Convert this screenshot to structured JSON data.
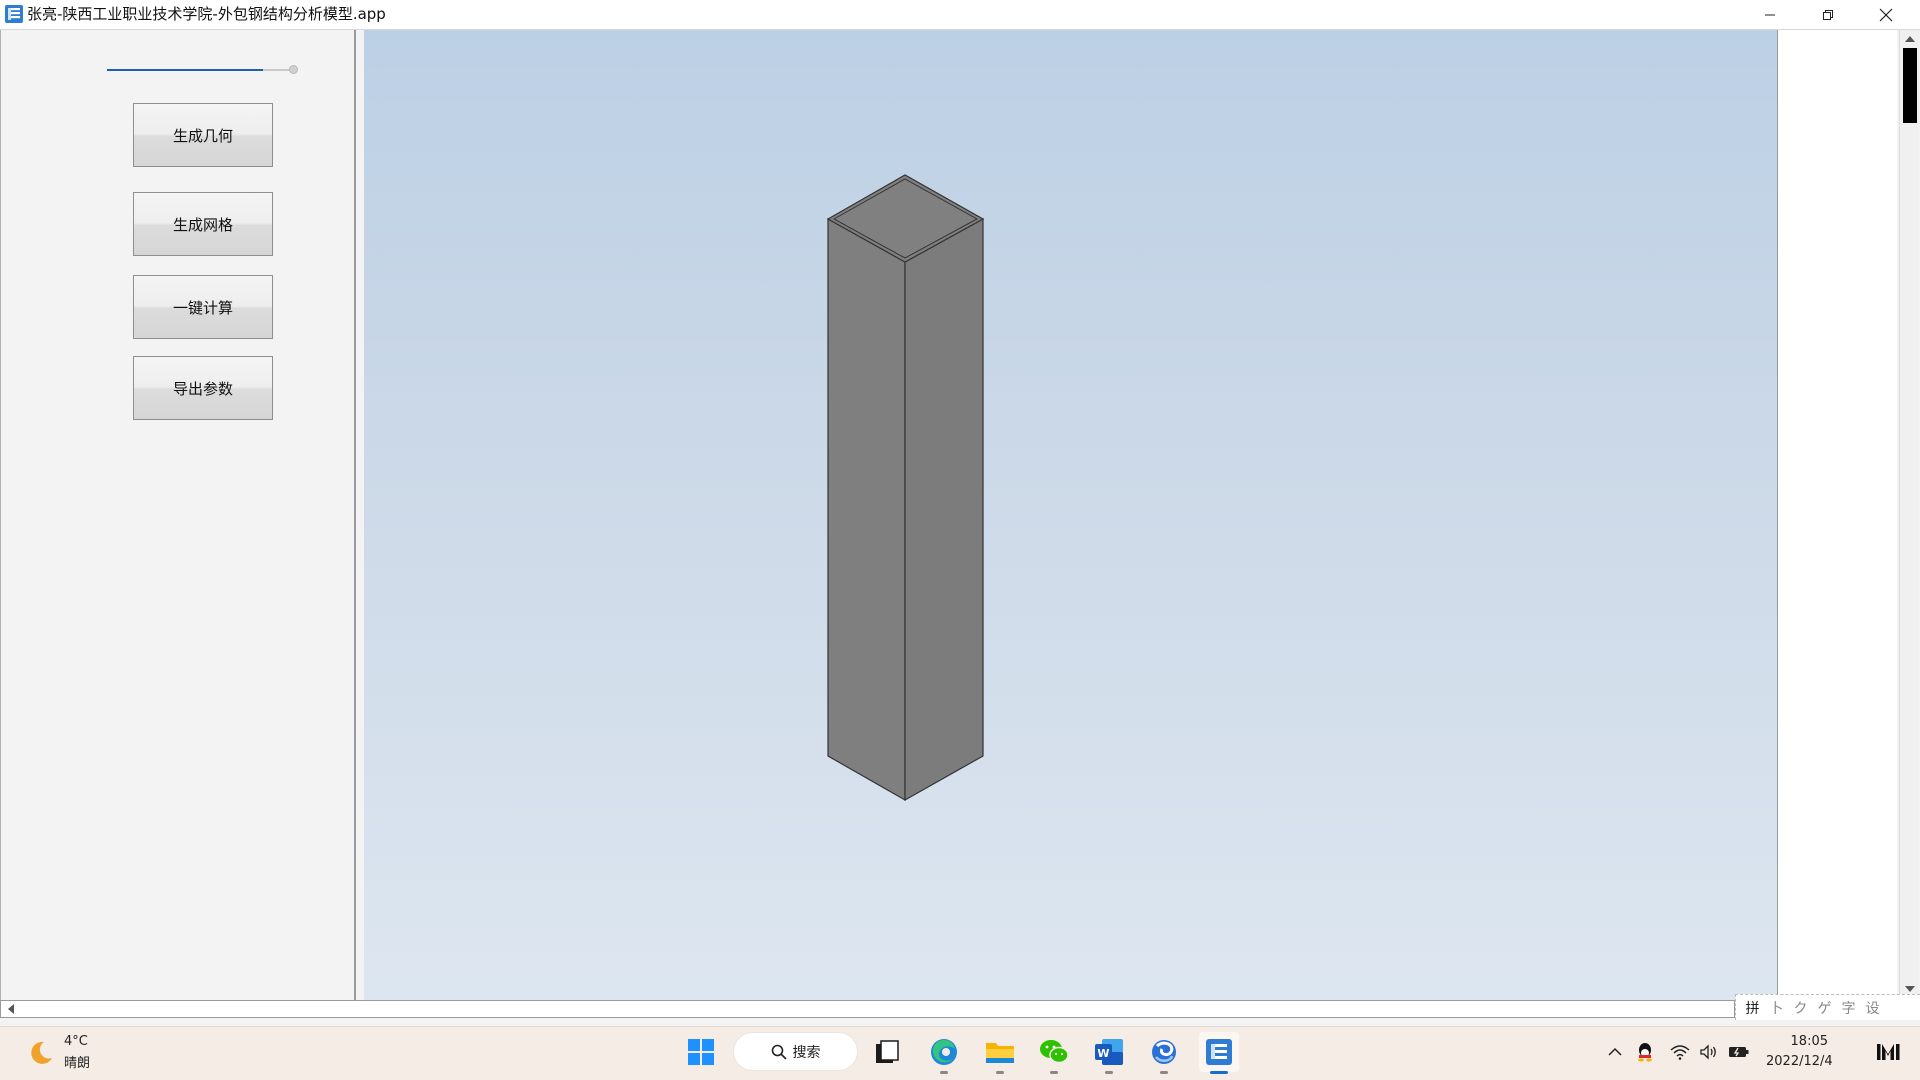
{
  "window": {
    "title": "张亮-陕西工业职业技术学院-外包钢结构分析模型.app",
    "minimize_icon": "minimize-icon",
    "restore_icon": "restore-icon",
    "close_icon": "close-icon"
  },
  "left_panel": {
    "progress_fraction": 0.82,
    "buttons": [
      {
        "label": "生成几何"
      },
      {
        "label": "生成网格"
      },
      {
        "label": "一键计算"
      },
      {
        "label": "导出参数"
      }
    ]
  },
  "viewport": {
    "model": "square-column-box",
    "background_top": "#bcd0e5",
    "background_bottom": "#dde6f0",
    "face_color": "#808080",
    "edge_color": "#333333"
  },
  "ime_toolbar": {
    "items": [
      "拼",
      "卜",
      "ク",
      "ゲ",
      "字",
      "设"
    ]
  },
  "taskbar": {
    "weather_temp": "4°C",
    "weather_desc": "晴朗",
    "search_label": "搜索",
    "clock_time": "18:05",
    "clock_date": "2022/12/4",
    "pinned": [
      "start-icon",
      "task-view-icon",
      "edge-icon",
      "file-explorer-icon",
      "wechat-icon",
      "word-icon",
      "browser-icon",
      "app-icon"
    ],
    "tray": [
      "chevron-up-icon",
      "qq-icon",
      "wifi-icon",
      "volume-icon",
      "battery-icon"
    ]
  },
  "colors": {
    "accent": "#1a6bd1",
    "taskbar_bg": "#f5ece6"
  }
}
